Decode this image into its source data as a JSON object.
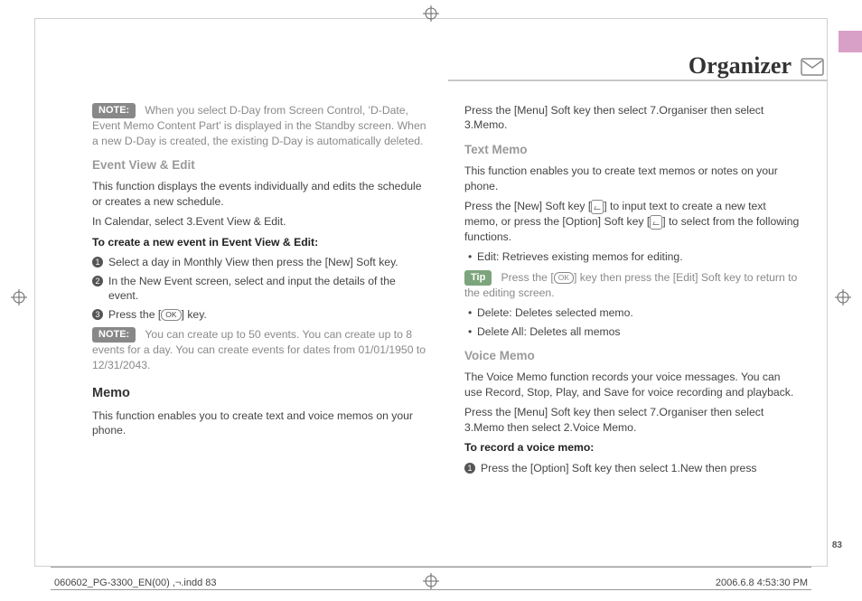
{
  "header": {
    "title": "Organizer"
  },
  "left": {
    "note1": {
      "label": "NOTE:",
      "text": "When you select D-Day from Screen Control, 'D-Date, Event Memo Content Part' is displayed in the Standby screen. When a new D-Day is created, the existing D-Day is automatically deleted."
    },
    "h_eventview": "Event View & Edit",
    "p_eventview_1": "This function displays the events individually and edits the schedule or creates a new schedule.",
    "p_eventview_2": "In Calendar, select 3.Event View & Edit.",
    "b_eventview_3": "To create a new event in Event View & Edit:",
    "steps": [
      "Select a day in Monthly View then press the [New] Soft key.",
      "In the New Event screen, select and input the details of the event.",
      "Press the [        ] key."
    ],
    "okLabel": "OK",
    "note2": {
      "label": "NOTE:",
      "text": "You can create up to 50 events. You can create up to 8 events for a day. You can create events for dates from 01/01/1950 to 12/31/2043."
    },
    "h_memo": "Memo",
    "p_memo_1": "This function enables you to create text and voice memos on your phone."
  },
  "right": {
    "p_intro": "Press the [Menu] Soft key then select 7.Organiser then select 3.Memo.",
    "h_text": "Text Memo",
    "p_text_1": "This function enables you to create text memos or notes on your phone.",
    "p_text_2a": "Press the [New] Soft key [",
    "p_text_2b": "] to input text to create a new text memo, or press the [Option] Soft key [",
    "p_text_2c": "] to select from the following functions.",
    "bul_edit": "Edit: Retrieves existing memos for editing.",
    "tip": {
      "label": "Tip",
      "text_a": "Press the [",
      "text_b": "] key then press the [Edit] Soft key to return to the editing screen."
    },
    "okLabel": "OK",
    "bul_delete": "Delete: Deletes selected memo.",
    "bul_deleteall": "Delete All: Deletes all memos",
    "h_voice": "Voice Memo",
    "p_voice_1": "The Voice Memo function records your voice messages. You can use Record, Stop, Play, and Save for voice recording and playback.",
    "p_voice_2": "Press the [Menu] Soft key then select 7.Organiser then select 3.Memo then select 2.Voice Memo.",
    "b_voice_3": "To record a voice memo:",
    "step_voice": "Press the [Option] Soft key then select 1.New then press"
  },
  "pageNumber": "83",
  "footer": {
    "left": "060602_PG-3300_EN(00) ,¬.indd   83",
    "right": "2006.6.8   4:53:30 PM"
  }
}
